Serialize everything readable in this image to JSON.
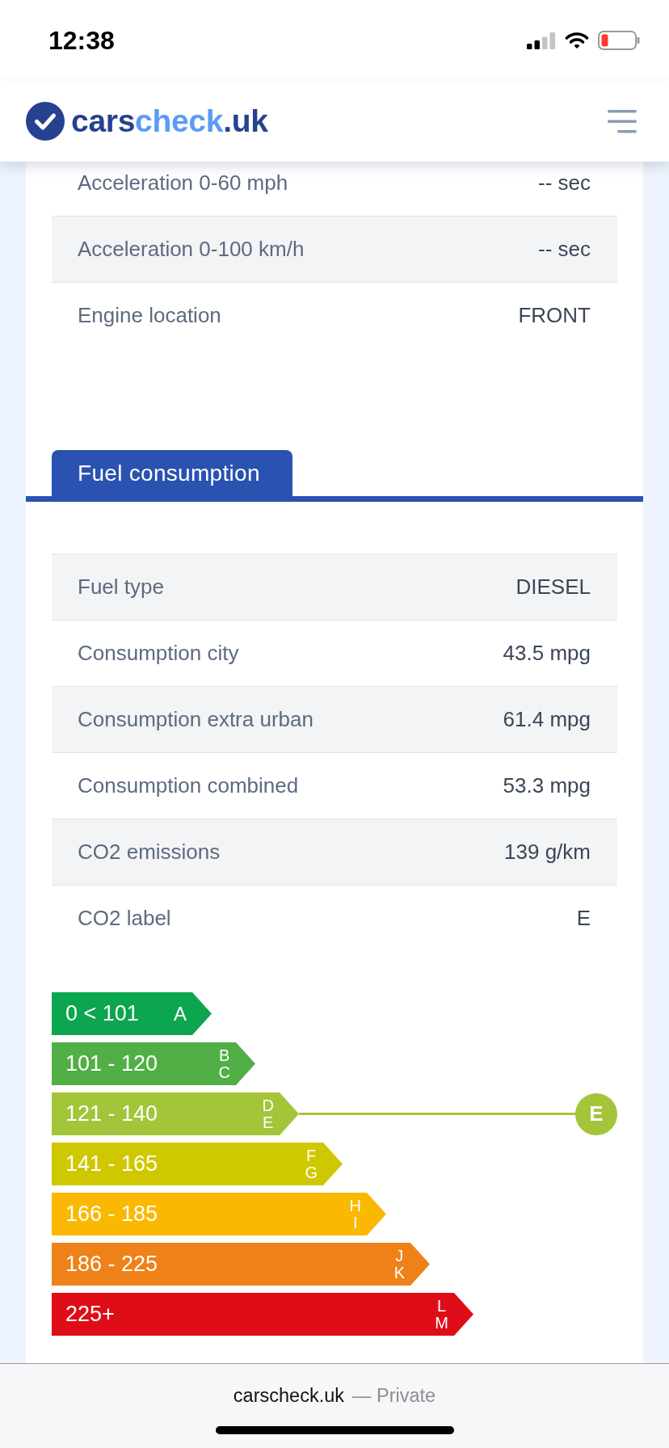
{
  "status_bar": {
    "time": "12:38"
  },
  "header": {
    "logo": [
      {
        "text": "cars",
        "highlight": false
      },
      {
        "text": "check",
        "highlight": true
      },
      {
        "text": ".uk",
        "highlight": false
      }
    ]
  },
  "performance_table": {
    "rows": [
      {
        "label": "Acceleration 0-60 mph",
        "value": "-- sec"
      },
      {
        "label": "Acceleration 0-100 km/h",
        "value": "-- sec"
      },
      {
        "label": "Engine location",
        "value": "FRONT"
      }
    ]
  },
  "tabs": [
    {
      "label": "Fuel consumption",
      "selected": true
    }
  ],
  "fuel_table": {
    "rows": [
      {
        "label": "Fuel type",
        "value": "DIESEL"
      },
      {
        "label": "Consumption city",
        "value": "43.5 mpg"
      },
      {
        "label": "Consumption extra urban",
        "value": "61.4 mpg"
      },
      {
        "label": "Consumption combined",
        "value": "53.3 mpg"
      },
      {
        "label": "CO2 emissions",
        "value": "139 g/km"
      },
      {
        "label": "CO2 label",
        "value": "E"
      }
    ]
  },
  "co2_scale": {
    "bands": [
      {
        "range": "0 < 101",
        "letters": [
          "A"
        ],
        "color": "#0ba64f",
        "selected": false
      },
      {
        "range": "101 - 120",
        "letters": [
          "B",
          "C"
        ],
        "color": "#52af46",
        "selected": false
      },
      {
        "range": "121 - 140",
        "letters": [
          "D",
          "E"
        ],
        "color": "#a4c43a",
        "selected": true
      },
      {
        "range": "141 - 165",
        "letters": [
          "F",
          "G"
        ],
        "color": "#cfc800",
        "selected": false
      },
      {
        "range": "166 - 185",
        "letters": [
          "H",
          "I"
        ],
        "color": "#fab900",
        "selected": false
      },
      {
        "range": "186 - 225",
        "letters": [
          "J",
          "K"
        ],
        "color": "#ee8219",
        "selected": false
      },
      {
        "range": "225+",
        "letters": [
          "L",
          "M"
        ],
        "color": "#df0d17",
        "selected": false
      }
    ],
    "rating": "E"
  },
  "browser_bar": {
    "url": "carscheck.uk",
    "mode": "— Private"
  }
}
